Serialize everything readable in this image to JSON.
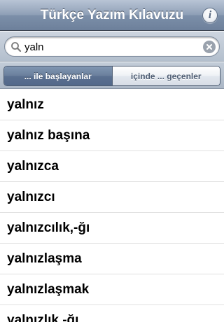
{
  "nav": {
    "title": "Türkçe Yazım Kılavuzu",
    "info_label": "i"
  },
  "search": {
    "value": "yaln",
    "placeholder": ""
  },
  "segments": [
    {
      "label": "... ile başlayanlar",
      "selected": true
    },
    {
      "label": "içinde ... geçenler",
      "selected": false
    }
  ],
  "results": [
    "yalnız",
    "yalnız başına",
    "yalnızca",
    "yalnızcı",
    "yalnızcılık,-ğı",
    "yalnızlaşma",
    "yalnızlaşmak",
    "yalnızlık,-ğı"
  ],
  "colors": {
    "navbar": "#7c8fa9",
    "segment_active": "#5b7090",
    "row_divider": "#e0e0e0"
  },
  "icons": {
    "info": "info-icon",
    "search": "search-icon",
    "clear": "clear-icon"
  }
}
